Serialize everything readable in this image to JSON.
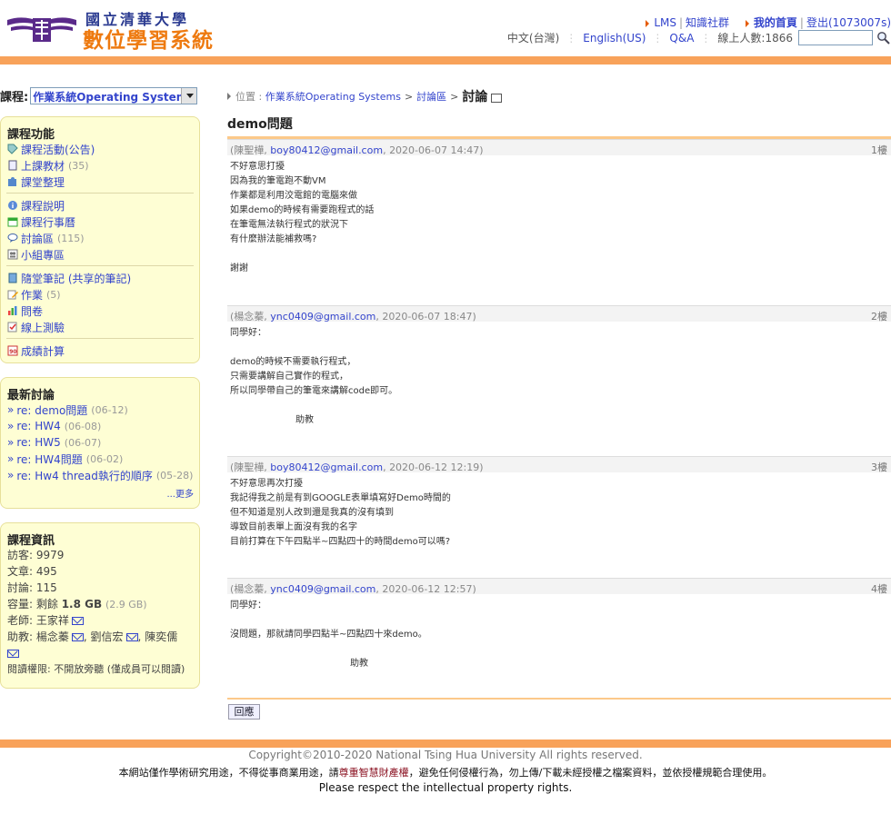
{
  "header": {
    "logo_line1": "國立清華大學",
    "logo_line2": "數位學習系統",
    "nav": {
      "lms": "LMS",
      "community": "知識社群",
      "my_home": "我的首頁",
      "logout": "登出(1073007s)"
    },
    "lang_zh": "中文(台灣)",
    "lang_en": "English(US)",
    "qa": "Q&A",
    "online_users": "線上人數:1866",
    "search_placeholder": ""
  },
  "sidebar": {
    "course_label": "課程:",
    "course_selected": "作業系統Operating Systems",
    "functions": {
      "title": "課程功能",
      "groups": [
        [
          {
            "label": "課程活動(公告)",
            "count": "",
            "icon": "tag-icon"
          },
          {
            "label": "上課教材",
            "count": "(35)",
            "icon": "document-icon"
          },
          {
            "label": "課堂整理",
            "count": "",
            "icon": "puzzle-icon"
          }
        ],
        [
          {
            "label": "課程說明",
            "count": "",
            "icon": "info-icon"
          },
          {
            "label": "課程行事曆",
            "count": "",
            "icon": "calendar-icon"
          },
          {
            "label": "討論區",
            "count": "(115)",
            "icon": "bubble-icon"
          },
          {
            "label": "小組專區",
            "count": "",
            "icon": "group-icon"
          }
        ],
        [
          {
            "label": "隨堂筆記 (共享的筆記)",
            "count": "",
            "icon": "notes-icon"
          },
          {
            "label": "作業",
            "count": "(5)",
            "icon": "pencil-icon"
          },
          {
            "label": "問卷",
            "count": "",
            "icon": "chart-icon"
          },
          {
            "label": "線上測驗",
            "count": "",
            "icon": "quiz-icon"
          }
        ],
        [
          {
            "label": "成績計算",
            "count": "",
            "icon": "grade-icon"
          }
        ]
      ]
    },
    "discussions": {
      "title": "最新討論",
      "items": [
        {
          "label": "re: demo問題",
          "date": "(06-12)"
        },
        {
          "label": "re: HW4",
          "date": "(06-08)"
        },
        {
          "label": "re: HW5",
          "date": "(06-07)"
        },
        {
          "label": "re: HW4問題",
          "date": "(06-02)"
        },
        {
          "label": "re: Hw4 thread執行的順序",
          "date": "(05-28)"
        }
      ],
      "more": "...更多"
    },
    "info": {
      "title": "課程資訊",
      "visitors": "訪客: 9979",
      "articles": "文章: 495",
      "discussions": "討論: 115",
      "capacity_prefix": "容量: 剩餘",
      "capacity_value": "1.8 GB",
      "capacity_total": "(2.9 GB)",
      "teacher_prefix": "老師:",
      "teacher": "王家祥",
      "ta_prefix": "助教:",
      "ta1": "楊念蓁",
      "ta2": "劉信宏",
      "ta3": "陳奕儒",
      "permission": "閱讀權限: 不開放旁聽 (僅成員可以閱讀)"
    }
  },
  "main": {
    "breadcrumb": {
      "location": "位置 :",
      "course": "作業系統Operating Systems",
      "sep": ">",
      "forum": "討論區",
      "current": "討論"
    },
    "thread_title": "demo問題",
    "posts": [
      {
        "author": "陳聖樺",
        "email": "boy80412@gmail.com",
        "time": "2020-06-07 14:47",
        "floor": "1樓",
        "lines": [
          "不好意思打擾",
          "因為我的筆電跑不動VM",
          "作業都是利用洨電館的電腦來做",
          "如果demo的時候有需要跑程式的話",
          "在筆電無法執行程式的狀況下",
          "有什麼辦法能補救嗎?",
          "",
          "謝謝"
        ]
      },
      {
        "author": "楊念蓁",
        "email": "ync0409@gmail.com",
        "time": "2020-06-07 18:47",
        "floor": "2樓",
        "lines": [
          "同學好：",
          "",
          "demo的時候不需要執行程式，",
          "只需要講解自己實作的程式，",
          "所以同學帶自己的筆電來講解code即可。",
          "",
          "助教"
        ]
      },
      {
        "author": "陳聖樺",
        "email": "boy80412@gmail.com",
        "time": "2020-06-12 12:19",
        "floor": "3樓",
        "lines": [
          "不好意思再次打擾",
          "我記得我之前是有到GOOGLE表單填寫好Demo時間的",
          "但不知道是別人改到還是我真的沒有填到",
          "導致目前表單上面沒有我的名字",
          "目前打算在下午四點半~四點四十的時間demo可以嗎?"
        ]
      },
      {
        "author": "楊念蓁",
        "email": "ync0409@gmail.com",
        "time": "2020-06-12 12:57",
        "floor": "4樓",
        "lines": [
          "同學好：",
          "",
          "沒問題，那就請同學四點半~四點四十來demo。",
          "",
          "助教"
        ]
      }
    ],
    "reply_label": "回應"
  },
  "footer": {
    "copyright": "Copyright©2010-2020 National Tsing Hua University All rights reserved.",
    "note_before": "本網站僅作學術研究用途，不得從事商業用途，請",
    "note_ip": "尊重智慧財產權",
    "note_after": "，避免任何侵權行為，勿上傳/下載未經授權之檔案資料，並依授權規範合理使用。",
    "note2": "Please respect the intellectual property rights."
  },
  "colors": {
    "accent_orange": "#f8a25a",
    "link_blue": "#3344cc",
    "panel_bg": "#fefed4"
  }
}
